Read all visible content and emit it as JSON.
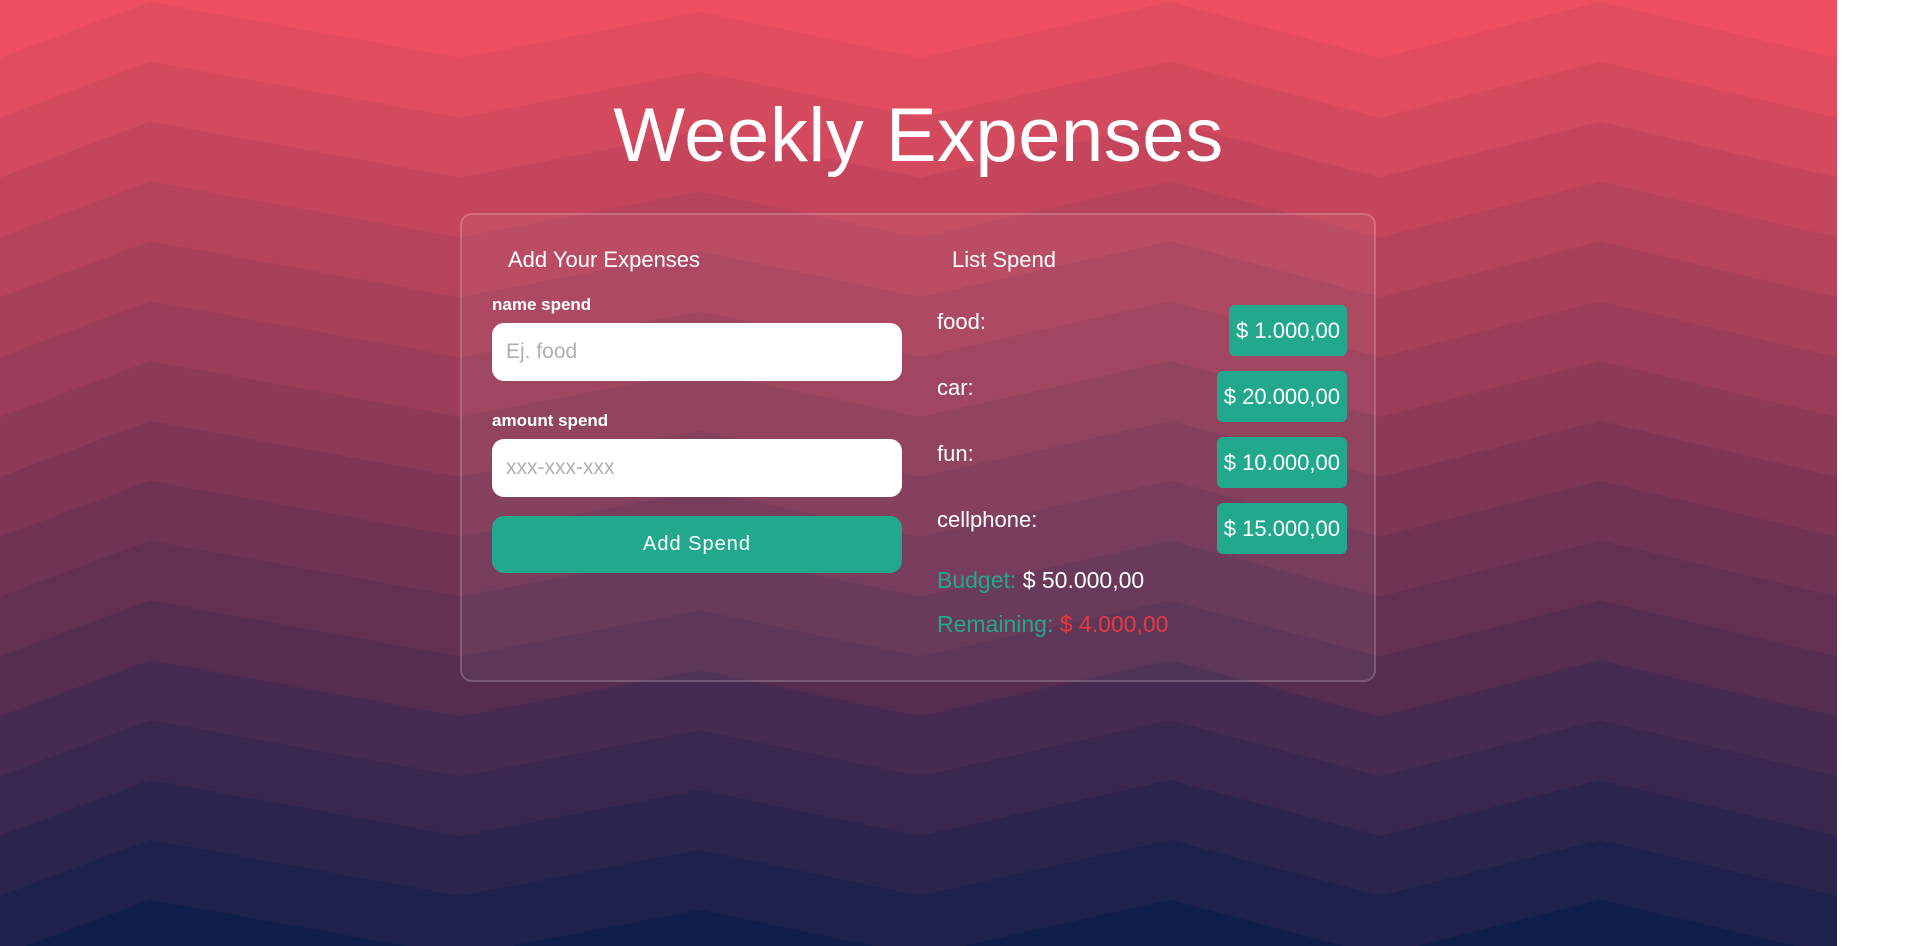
{
  "page": {
    "title": "Weekly Expenses"
  },
  "form": {
    "heading": "Add Your Expenses",
    "name_label": "name spend",
    "name_placeholder": "Ej. food",
    "name_value": "",
    "amount_label": "amount spend",
    "amount_placeholder": "xxx-xxx-xxx",
    "amount_value": "",
    "submit_label": "Add Spend"
  },
  "list": {
    "heading": "List Spend",
    "items": [
      {
        "name": "food:",
        "amount": "$ 1.000,00"
      },
      {
        "name": "car:",
        "amount": "$ 20.000,00"
      },
      {
        "name": "fun:",
        "amount": "$ 10.000,00"
      },
      {
        "name": "cellphone:",
        "amount": "$ 15.000,00"
      }
    ],
    "budget_label": "Budget:",
    "budget_value": "$ 50.000,00",
    "remaining_label": "Remaining:",
    "remaining_value": "$ 4.000,00"
  },
  "colors": {
    "accent": "#22a88c",
    "danger": "#e8393f",
    "background_top": "#fd5262",
    "background_bottom": "#0f1e4a"
  }
}
